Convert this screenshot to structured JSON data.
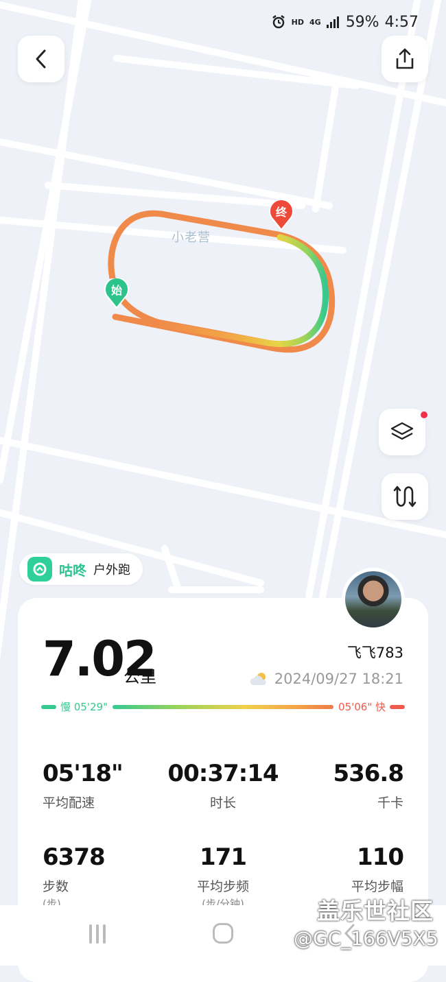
{
  "status_bar": {
    "hd": "HD",
    "network": "4G",
    "battery": "59%",
    "time": "4:57"
  },
  "map": {
    "place_label": "小老营",
    "start_marker": "始",
    "end_marker": "终"
  },
  "app": {
    "brand": "咕咚",
    "activity_type": "户外跑"
  },
  "summary": {
    "distance": "7.02",
    "distance_unit": "公里",
    "username": "飞飞783",
    "datetime": "2024/09/27 18:21"
  },
  "pace_range": {
    "slow_label": "慢 05'29\"",
    "fast_label": "05'06\" 快"
  },
  "stats": {
    "avg_pace": {
      "value": "05'18\"",
      "label": "平均配速"
    },
    "duration": {
      "value": "00:37:14",
      "label": "时长"
    },
    "calories": {
      "value": "536.8",
      "label": "千卡"
    },
    "steps": {
      "value": "6378",
      "label": "步数",
      "unit": "(步)"
    },
    "cadence": {
      "value": "171",
      "label": "平均步频",
      "unit": "(步/分钟)"
    },
    "stride": {
      "value": "110",
      "label": "平均步幅"
    }
  },
  "watermark": {
    "line1": "盖乐世社区",
    "line2": "@GC_166V5X5"
  },
  "colors": {
    "brand_green": "#2cc38f",
    "slow": "#35c98f",
    "fast": "#ef5a4a"
  }
}
